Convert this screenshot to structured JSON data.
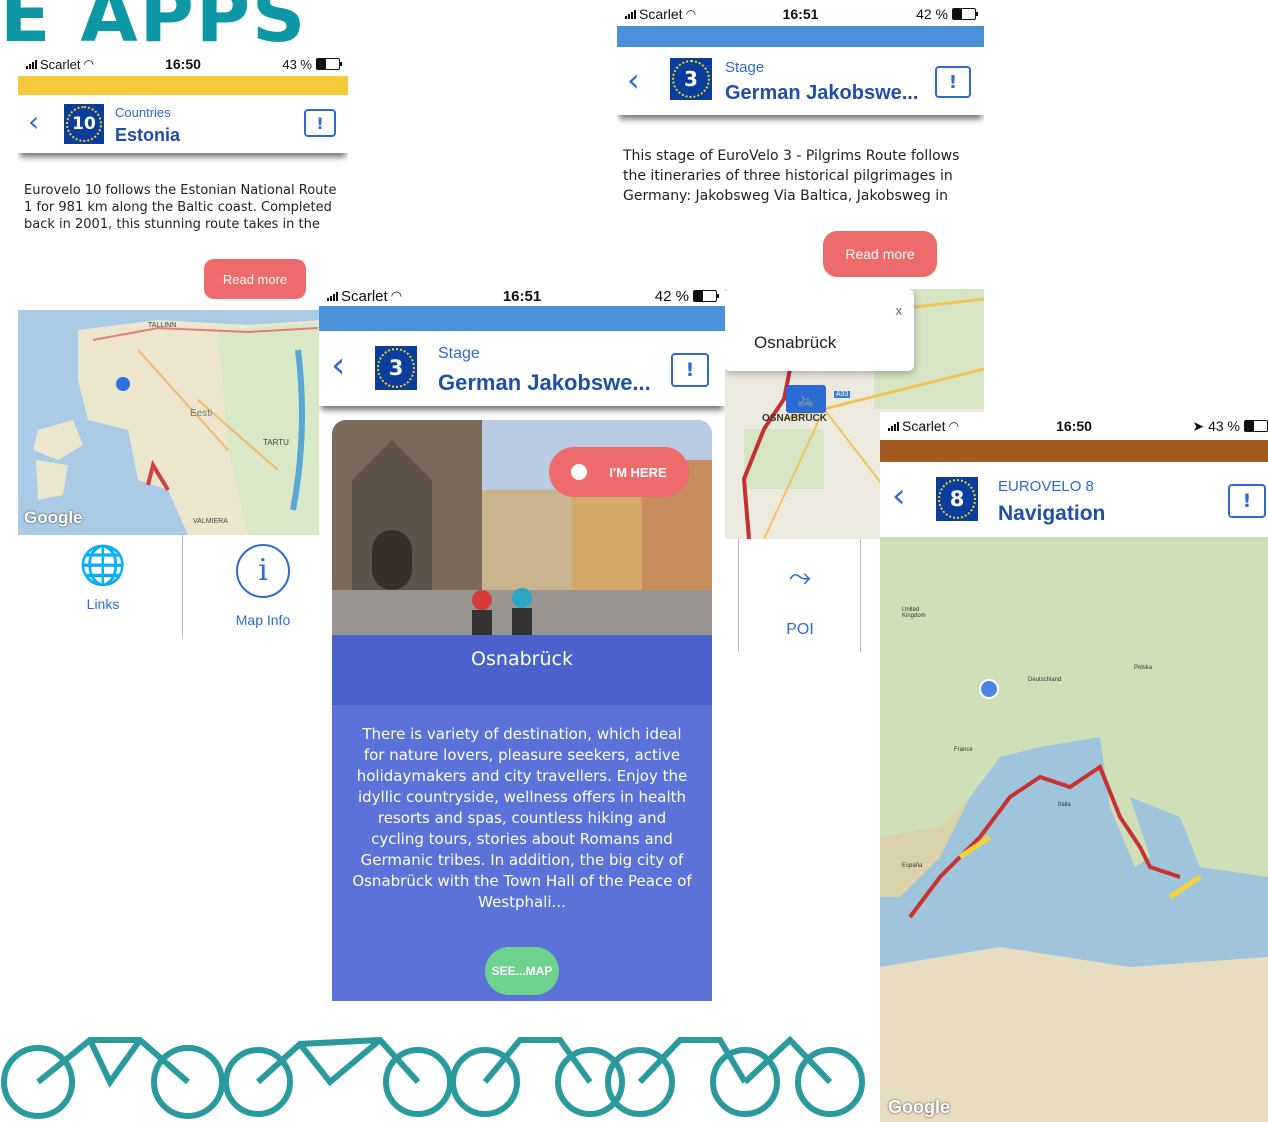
{
  "banner": {
    "title": "E APPS"
  },
  "screen_estonia": {
    "status": {
      "carrier": "Scarlet",
      "time": "16:50",
      "battery": "43 %"
    },
    "accent_color": "#f4c93a",
    "badge": "10",
    "breadcrumb": "Countries",
    "heading": "Estonia",
    "description": "Eurovelo 10 follows the Estonian National Route 1 for 981 km along the Baltic coast. Completed back in 2001, this stunning route takes in the",
    "read_more": "Read more",
    "map": {
      "label_country": "Eesti",
      "label_city": "TARTU",
      "label_city2": "VALMIERA",
      "label_town": "TALLINN",
      "google": "Google"
    },
    "links": "Links",
    "map_info": "Map Info"
  },
  "screen_stage_top": {
    "status": {
      "carrier": "Scarlet",
      "time": "16:51",
      "battery": "42 %"
    },
    "accent_color": "#4a90d9",
    "badge": "3",
    "breadcrumb": "Stage",
    "heading": "German Jakobswe...",
    "description": "This stage of EuroVelo 3 - Pilgrims Route follows the itineraries of three historical pilgrimages in Germany: Jakobsweg Via Baltica, Jakobsweg in",
    "read_more": "Read more"
  },
  "screen_map_osnabruck": {
    "popup_close": "x",
    "popup_title": "Osnabrück",
    "map_label": "OSNABRÜCK",
    "poi": "POI",
    "road": "A33"
  },
  "screen_stage_mid": {
    "status": {
      "carrier": "Scarlet",
      "time": "16:51",
      "battery": "42 %"
    },
    "accent_color": "#4a90d9",
    "badge": "3",
    "breadcrumb": "Stage",
    "heading": "German Jakobswe...",
    "im_here": "I'M HERE",
    "place": "Osnabrück",
    "description": "There is variety of destination, which ideal for nature lovers, pleasure seekers, active holidaymakers and city travellers. Enjoy the idyllic countryside, wellness offers in health resorts and spas, countless hiking and cycling tours, stories about Romans and Germanic tribes. In addition, the big city of Osnabrück with the Town Hall of the Peace of Westphali...",
    "see_map": "SEE...MAP",
    "panel_color": "#5b73d8"
  },
  "screen_navigation": {
    "status": {
      "carrier": "Scarlet",
      "time": "16:50",
      "battery": "43 %"
    },
    "accent_color": "#a35a1e",
    "badge": "8",
    "breadcrumb": "EUROVELO 8",
    "heading": "Navigation",
    "google": "Google",
    "map_labels": {
      "uk": "United Kingdom",
      "de": "Deutschland",
      "fr": "France",
      "it": "Italia",
      "pl": "Polska",
      "es": "España"
    }
  }
}
